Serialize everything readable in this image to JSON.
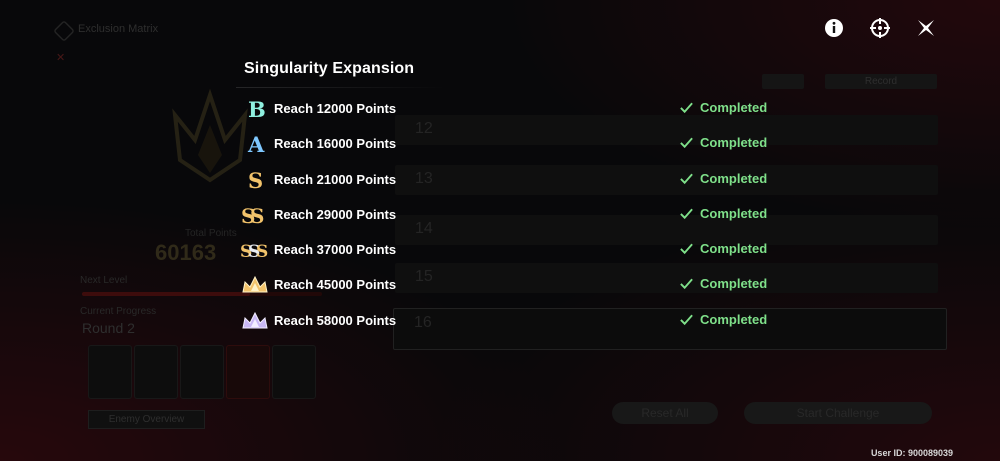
{
  "panel": {
    "title": "Singularity Expansion"
  },
  "milestones": [
    {
      "rank_icon": "rank-b-icon",
      "label": "Reach 12000 Points",
      "status": "Completed"
    },
    {
      "rank_icon": "rank-a-icon",
      "label": "Reach 16000 Points",
      "status": "Completed"
    },
    {
      "rank_icon": "rank-s-icon",
      "label": "Reach 21000 Points",
      "status": "Completed"
    },
    {
      "rank_icon": "rank-ss-icon",
      "label": "Reach 29000 Points",
      "status": "Completed"
    },
    {
      "rank_icon": "rank-sss-icon",
      "label": "Reach 37000 Points",
      "status": "Completed"
    },
    {
      "rank_icon": "rank-crown-gold-icon",
      "label": "Reach 45000 Points",
      "status": "Completed"
    },
    {
      "rank_icon": "rank-crown-purple-icon",
      "label": "Reach 58000 Points",
      "status": "Completed"
    }
  ],
  "top_icons": [
    "info-icon",
    "target-icon",
    "close-icon"
  ],
  "background": {
    "title": "Exclusion Matrix",
    "total_points_label": "Total Points",
    "total_points_value": "60163",
    "next_level_label": "Next Level",
    "current_progress_label": "Current Progress",
    "current_round": "Round 2",
    "enemy_overview_label": "Enemy Overview",
    "record_label": "Record",
    "rows": [
      "12",
      "13",
      "14",
      "15",
      "16"
    ],
    "reset_label": "Reset All",
    "start_label": "Start Challenge"
  },
  "footer": {
    "user_id": "User ID: 900089039"
  },
  "colors": {
    "completed_green": "#7fe08a",
    "rank_b": "#8ff0e0",
    "rank_a": "#7fc8ff",
    "rank_s_gold": "#f2c36b",
    "rank_crown_purple": "#c9b8f5"
  }
}
